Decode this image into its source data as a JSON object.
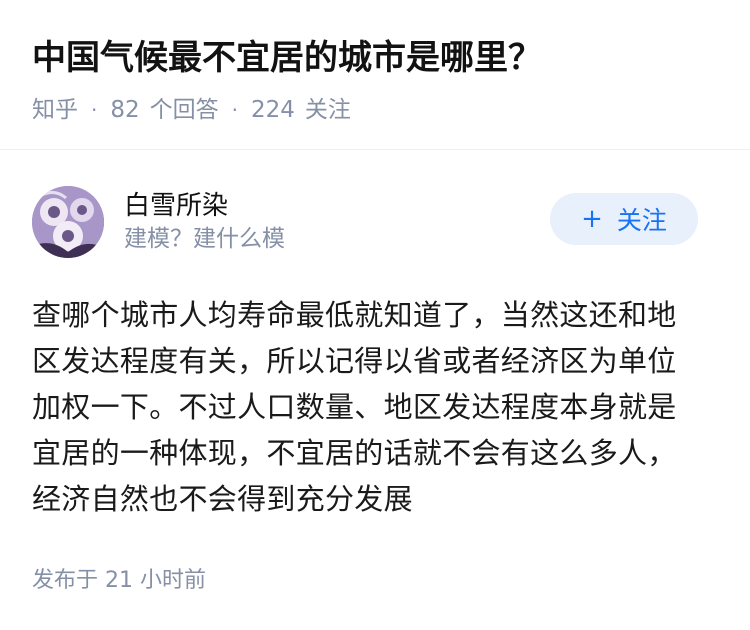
{
  "question": {
    "title": "中国气候最不宜居的城市是哪里？",
    "source": "知乎",
    "separator": "·",
    "answer_count": "82",
    "answer_label": "个回答",
    "follower_count": "224",
    "follower_label": "关注"
  },
  "answer": {
    "author": {
      "name": "白雪所染",
      "bio": "建模？建什么模",
      "avatar_icon": "anime-avatar-icon"
    },
    "follow_button": {
      "plus": "+",
      "label": "关注"
    },
    "content_lines": [
      "查哪个城市人均寿命最低就知道了，当然这还和地",
      "区发达程度有关，所以记得以省或者经济区为单位",
      "加权一下。不过人口数量、地区发达程度本身就是",
      "宜居的一种体现，不宜居的话就不会有这么多人，",
      "经济自然也不会得到充分发展"
    ],
    "publish_time": "发布于  21 小时前"
  },
  "colors": {
    "meta_gray": "#8590a6",
    "follow_blue": "#1772f6",
    "follow_bg": "#e8f0fb"
  }
}
